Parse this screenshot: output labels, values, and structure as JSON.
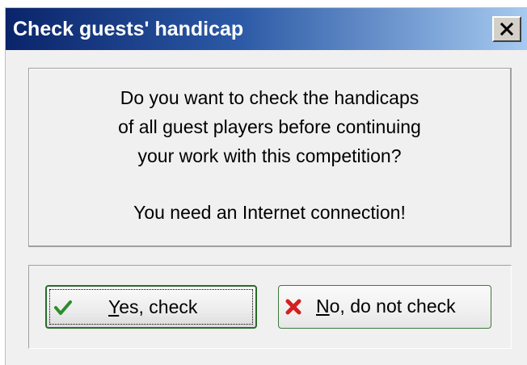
{
  "dialog": {
    "title": "Check guests' handicap",
    "close_label": "×",
    "message_lines": [
      "Do you want to check the handicaps",
      "of all guest players before continuing",
      "your work with this competition?",
      "You need an Internet connection!"
    ]
  },
  "buttons": {
    "yes": {
      "mnemonic": "Y",
      "rest": "es, check",
      "icon": "checkmark-icon",
      "icon_color": "#2e8b2e"
    },
    "no": {
      "mnemonic": "N",
      "rest": "o, do not check",
      "icon": "x-icon",
      "icon_color": "#d42020"
    }
  },
  "colors": {
    "titlebar_start": "#0a246a",
    "titlebar_end": "#a6caf0",
    "button_border": "#3d7a3d",
    "dialog_bg": "#f0f0f0"
  }
}
